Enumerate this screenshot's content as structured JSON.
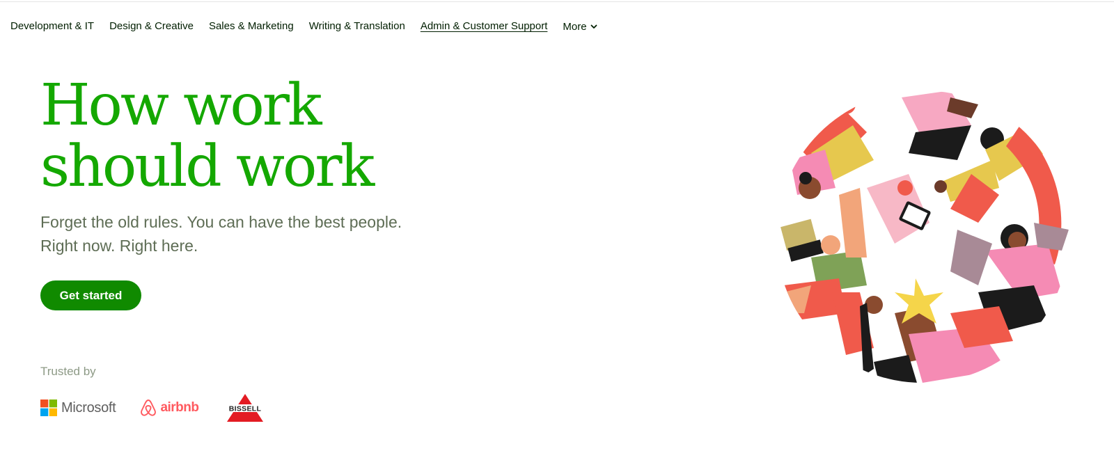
{
  "nav": {
    "items": [
      {
        "label": "Development & IT"
      },
      {
        "label": "Design & Creative"
      },
      {
        "label": "Sales & Marketing"
      },
      {
        "label": "Writing & Translation"
      },
      {
        "label": "Admin & Customer Support",
        "hovered": true
      }
    ],
    "more_label": "More",
    "more_icon": "chevron-down-icon"
  },
  "hero": {
    "title_line1": "How work",
    "title_line2": "should work",
    "subtitle_line1": "Forget the old rules. You can have the best people.",
    "subtitle_line2": "Right now. Right here.",
    "cta_label": "Get started"
  },
  "trusted": {
    "label": "Trusted by",
    "logos": [
      {
        "name": "Microsoft",
        "icon": "microsoft-logo"
      },
      {
        "name": "airbnb",
        "icon": "airbnb-logo"
      },
      {
        "name": "BISSELL",
        "icon": "bissell-logo"
      }
    ]
  },
  "colors": {
    "brand_green": "#14a800",
    "button_green": "#108a00",
    "text_muted": "#5e6d55",
    "airbnb_red": "#ff5a5f",
    "bissell_red": "#e31b23"
  }
}
